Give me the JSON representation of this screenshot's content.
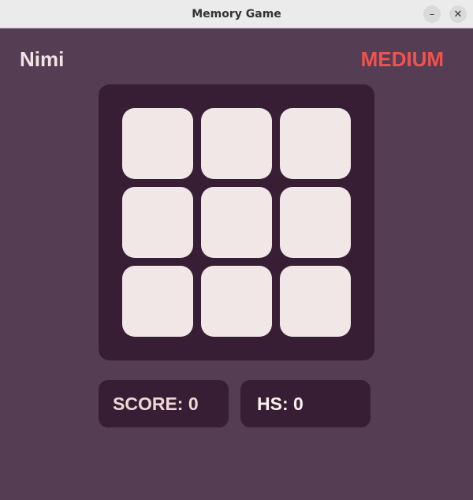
{
  "window": {
    "title": "Memory Game",
    "minimize_glyph": "–",
    "close_glyph": "✕"
  },
  "header": {
    "player_name": "Nimi",
    "difficulty": "MEDIUM"
  },
  "board": {
    "rows": 3,
    "columns": 3,
    "cards_face_down": 9
  },
  "stats": {
    "score": "SCORE: 0",
    "high_score": "HS: 0"
  },
  "colors": {
    "background": "#553d54",
    "board": "#371e34",
    "card_back": "#f1e7e6",
    "difficulty_accent": "#f0524f"
  }
}
